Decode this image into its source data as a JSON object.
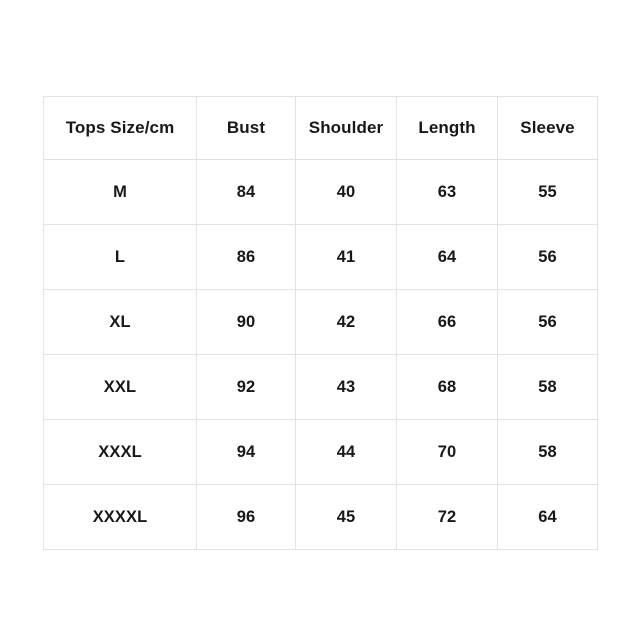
{
  "page": {
    "background_color": "#ffffff",
    "text_color": "#181818",
    "border_color": "#e3e3e3"
  },
  "table": {
    "name": "tops-size-chart",
    "columns": [
      "Tops Size/cm",
      "Bust",
      "Shoulder",
      "Length",
      "Sleeve"
    ],
    "rows": [
      {
        "size": "M",
        "bust": "84",
        "shoulder": "40",
        "length": "63",
        "sleeve": "55"
      },
      {
        "size": "L",
        "bust": "86",
        "shoulder": "41",
        "length": "64",
        "sleeve": "56"
      },
      {
        "size": "XL",
        "bust": "90",
        "shoulder": "42",
        "length": "66",
        "sleeve": "56"
      },
      {
        "size": "XXL",
        "bust": "92",
        "shoulder": "43",
        "length": "68",
        "sleeve": "58"
      },
      {
        "size": "XXXL",
        "bust": "94",
        "shoulder": "44",
        "length": "70",
        "sleeve": "58"
      },
      {
        "size": "XXXXL",
        "bust": "96",
        "shoulder": "45",
        "length": "72",
        "sleeve": "64"
      }
    ]
  },
  "chart_data": {
    "type": "table",
    "title": "",
    "categories": [
      "M",
      "L",
      "XL",
      "XXL",
      "XXXL",
      "XXXXL"
    ],
    "columns": [
      "Tops Size/cm",
      "Bust",
      "Shoulder",
      "Length",
      "Sleeve"
    ],
    "unit": "cm",
    "series": [
      {
        "name": "Bust",
        "values": [
          84,
          86,
          90,
          92,
          94,
          96
        ]
      },
      {
        "name": "Shoulder",
        "values": [
          40,
          41,
          42,
          43,
          44,
          45
        ]
      },
      {
        "name": "Length",
        "values": [
          63,
          64,
          66,
          68,
          70,
          72
        ]
      },
      {
        "name": "Sleeve",
        "values": [
          55,
          56,
          56,
          58,
          58,
          64
        ]
      }
    ]
  }
}
